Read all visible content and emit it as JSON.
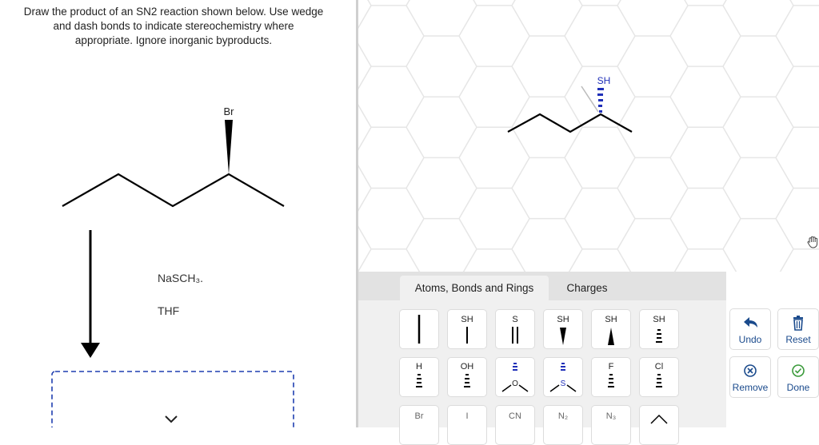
{
  "question": {
    "line1": "Draw the product of an SN2 reaction shown below. Use wedge",
    "line2": "and dash bonds to indicate stereochemistry where",
    "line3": "appropriate. Ignore inorganic byproducts."
  },
  "reaction": {
    "reactant_atom_label": "Br",
    "reagent": "NaSCH₃.",
    "solvent": "THF"
  },
  "canvas": {
    "product_atom_label": "SH"
  },
  "tabs": [
    {
      "label": "Atoms, Bonds and Rings"
    },
    {
      "label": "Charges"
    }
  ],
  "tools": {
    "row1": [
      "",
      "SH",
      "S",
      "SH",
      "SH",
      "SH"
    ],
    "row2": [
      "H",
      "OH",
      "",
      "",
      "F",
      "Cl"
    ],
    "row3": [
      "Br",
      "I",
      "CN",
      "N₂",
      "N₃",
      ""
    ]
  },
  "actions": {
    "undo": "Undo",
    "reset": "Reset",
    "remove": "Remove",
    "done": "Done"
  },
  "colors": {
    "accent": "#1a4a8c",
    "done": "#3a9a3a",
    "stereo": "#1f2fb8"
  }
}
